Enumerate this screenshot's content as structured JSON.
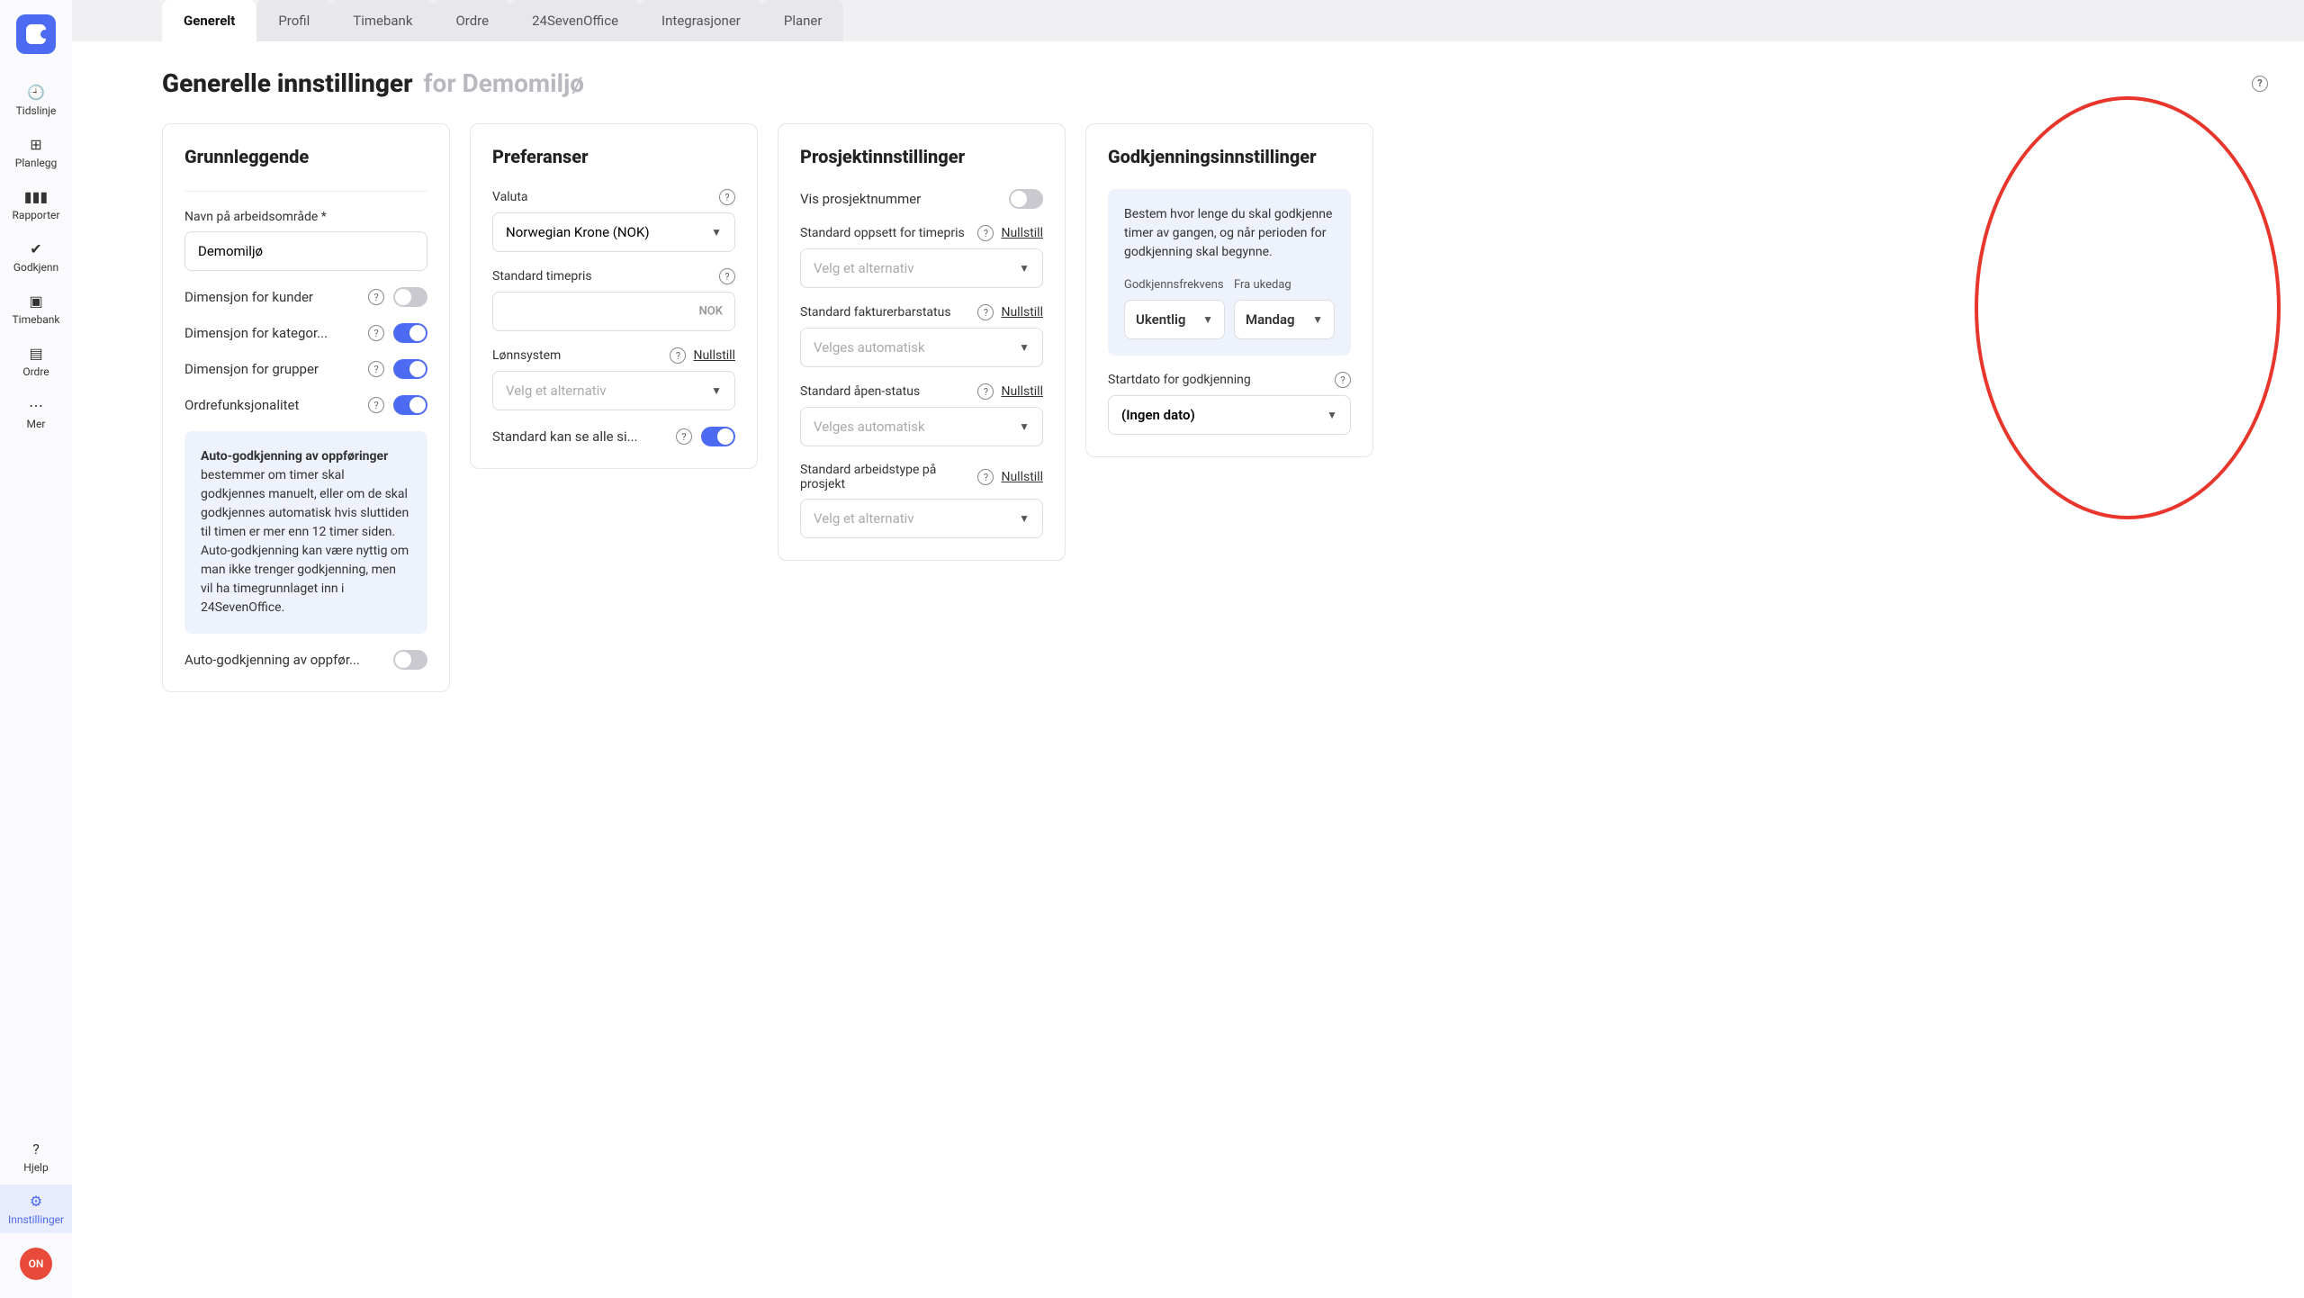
{
  "sidebar": {
    "items": [
      {
        "label": "Tidslinje",
        "icon": "clock"
      },
      {
        "label": "Planlegg",
        "icon": "plan"
      },
      {
        "label": "Rapporter",
        "icon": "chart"
      },
      {
        "label": "Godkjenn",
        "icon": "check"
      },
      {
        "label": "Timebank",
        "icon": "bank"
      },
      {
        "label": "Ordre",
        "icon": "receipt"
      },
      {
        "label": "Mer",
        "icon": "more"
      }
    ],
    "bottom": [
      {
        "label": "Hjelp",
        "icon": "help"
      },
      {
        "label": "Innstillinger",
        "icon": "gear",
        "active": true
      }
    ],
    "avatar": "ON"
  },
  "tabs": [
    "Generelt",
    "Profil",
    "Timebank",
    "Ordre",
    "24SevenOffice",
    "Integrasjoner",
    "Planer"
  ],
  "activeTab": "Generelt",
  "pageTitle": {
    "main": "Generelle innstillinger",
    "sub": "for Demomiljø"
  },
  "card1": {
    "title": "Grunnleggende",
    "nameLabel": "Navn på arbeidsområde *",
    "nameValue": "Demomiljø",
    "toggles": [
      {
        "label": "Dimensjon for kunder",
        "on": false
      },
      {
        "label": "Dimensjon for kategor...",
        "on": true
      },
      {
        "label": "Dimensjon for grupper",
        "on": true
      },
      {
        "label": "Ordrefunksjonalitet",
        "on": true
      }
    ],
    "infoTitle": "Auto-godkjenning av oppføringer",
    "infoBody": " bestemmer om timer skal godkjennes manuelt, eller om de skal godkjennes automatisk hvis sluttiden til timen er mer enn 12 timer siden. Auto-godkjenning kan være nyttig om man ikke trenger godkjenning, men vil ha timegrunnlaget inn i 24SevenOffice.",
    "autoApproveLabel": "Auto-godkjenning av oppfør...",
    "autoApproveOn": false
  },
  "card2": {
    "title": "Preferanser",
    "currencyLabel": "Valuta",
    "currencyValue": "Norwegian Krone (NOK)",
    "rateLabel": "Standard timepris",
    "rateSuffix": "NOK",
    "payrollLabel": "Lønnsystem",
    "payrollPlaceholder": "Velg et alternativ",
    "reset": "Nullstill",
    "seeAllLabel": "Standard kan se alle si...",
    "seeAllOn": true
  },
  "card3": {
    "title": "Prosjektinnstillinger",
    "showProjectNumLabel": "Vis prosjektnummer",
    "showProjectNumOn": false,
    "timepriceLabel": "Standard oppsett for timepris",
    "reset": "Nullstill",
    "selectPlaceholder": "Velg et alternativ",
    "billableLabel": "Standard fakturerbarstatus",
    "autoPlaceholder": "Velges automatisk",
    "openLabel": "Standard åpen-status",
    "worktypeLabel": "Standard arbeidstype på prosjekt"
  },
  "card4": {
    "title": "Godkjenningsinnstillinger",
    "info": "Bestem hvor lenge du skal godkjenne timer av gangen, og når perioden for godkjenning skal begynne.",
    "freqLabel": "Godkjennsfrekvens",
    "freqValue": "Ukentlig",
    "weekdayLabel": "Fra ukedag",
    "weekdayValue": "Mandag",
    "startLabel": "Startdato for godkjenning",
    "startValue": "(Ingen dato)"
  }
}
